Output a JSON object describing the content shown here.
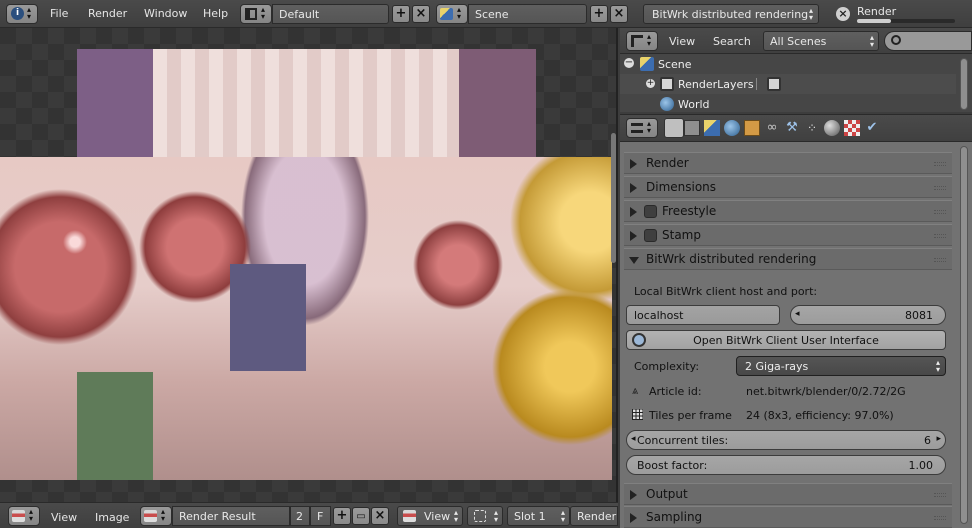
{
  "topbar": {
    "menus": [
      "File",
      "Render",
      "Window",
      "Help"
    ],
    "layout": "Default",
    "scene": "Scene",
    "engine": "BitWrk distributed rendering",
    "render_label": "Render"
  },
  "bottombar": {
    "view": "View",
    "image": "Image",
    "image_name": "Render Result",
    "users": "2",
    "fake": "F",
    "view_select": "View",
    "slot": "Slot 1",
    "render_layer": "RenderL"
  },
  "outliner": {
    "view": "View",
    "search": "Search",
    "filter": "All Scenes",
    "items": [
      "Scene",
      "RenderLayers",
      "World"
    ]
  },
  "properties": {
    "panels_top": [
      "Render",
      "Dimensions",
      "Freestyle",
      "Stamp"
    ],
    "bitwrk_panel": "BitWrk distributed rendering",
    "host_label": "Local BitWrk client host and port:",
    "host_value": "localhost",
    "port_value": "8081",
    "open_ui_button": "Open BitWrk Client User Interface",
    "complexity_label": "Complexity:",
    "complexity_value": "2 Giga-rays",
    "article_label": "Article id:",
    "article_value": "net.bitwrk/blender/0/2.72/2G",
    "tiles_label": "Tiles per frame",
    "tiles_value": "24  (8x3, efficiency: 97.0%)",
    "concurrent_label": "Concurrent tiles:",
    "concurrent_value": "6",
    "boost_label": "Boost factor:",
    "boost_value": "1.00",
    "panels_bottom": [
      "Output",
      "Sampling"
    ]
  },
  "colors": {
    "tile_purple_1": "#7d5f86",
    "tile_purple_2": "#7e5c75",
    "tile_blue": "#5e5a80",
    "tile_green": "#5f7b59"
  }
}
